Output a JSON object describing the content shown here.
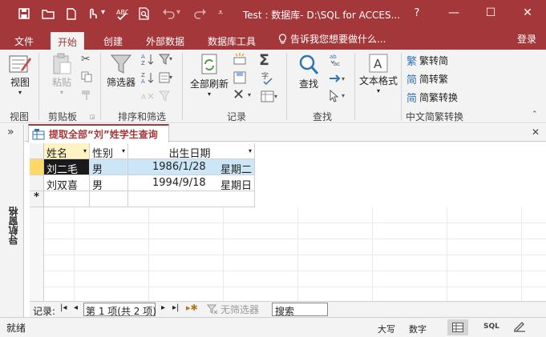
{
  "titlebar": {
    "title": "Test : 数据库- D:\\SQL for ACCES...",
    "help": "?",
    "minimize": "—",
    "maximize": "☐",
    "close": "✕"
  },
  "tabs": [
    {
      "label": "文件"
    },
    {
      "label": "开始"
    },
    {
      "label": "创建"
    },
    {
      "label": "外部数据"
    },
    {
      "label": "数据库工具"
    }
  ],
  "tell_me": "告诉我您想要做什么...",
  "login": "登录",
  "ribbon": {
    "views": {
      "view": "视图",
      "group": "视图"
    },
    "clipboard": {
      "paste": "粘贴",
      "group": "剪贴板"
    },
    "sort": {
      "filter": "筛选器",
      "group": "排序和筛选"
    },
    "records": {
      "refresh": "全部刷新",
      "group": "记录"
    },
    "find": {
      "find": "查找",
      "group": "查找"
    },
    "text": {
      "format": "文本格式"
    },
    "chinese": {
      "trad": "繁转简",
      "simp": "简转繁",
      "convert": "简繁转换",
      "group": "中文简繁转换"
    }
  },
  "nav": {
    "expand": "»",
    "label": "导航窗格"
  },
  "document": {
    "tab_title": "提取全部“刘”姓学生查询",
    "close": "✕"
  },
  "datasheet": {
    "columns": [
      "姓名",
      "性别",
      "出生日期"
    ],
    "rows": [
      [
        "刘二毛",
        "男",
        "1986/1/28",
        "星期二"
      ],
      [
        "刘双喜",
        "男",
        "1994/9/18",
        "星期日"
      ]
    ],
    "new_row_marker": "*"
  },
  "record_nav": {
    "label": "记录:",
    "position": "第 1 项(共 2 项)",
    "filter": "无筛选器",
    "search": "搜索"
  },
  "status": {
    "ready": "就绪",
    "caps": "大写",
    "num": "数字"
  },
  "colors": {
    "accent": "#a4373a",
    "selected_row": "#ffd965",
    "selected_cell": "#cde6f7"
  }
}
